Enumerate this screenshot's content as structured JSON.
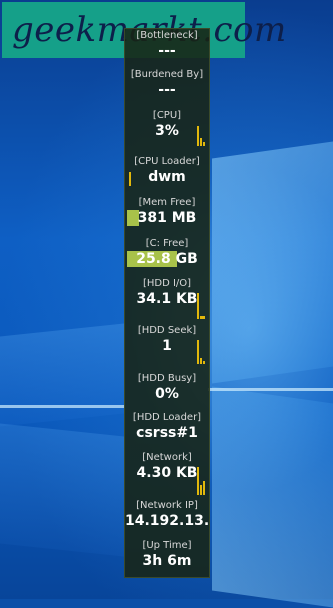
{
  "watermark": {
    "text": "geekmarkt.com"
  },
  "gadget": {
    "items": [
      {
        "label": "[Bottleneck]",
        "value": "---"
      },
      {
        "label": "[Burdened By]",
        "value": "---"
      },
      {
        "label": "[CPU]",
        "value": "3%"
      },
      {
        "label": "[CPU Loader]",
        "value": "dwm"
      },
      {
        "label": "[Mem Free]",
        "value": "381 MB"
      },
      {
        "label": "[C: Free]",
        "value": "25.8 GB"
      },
      {
        "label": "[HDD I/O]",
        "value": "34.1 KB"
      },
      {
        "label": "[HDD Seek]",
        "value": "1"
      },
      {
        "label": "[HDD Busy]",
        "value": "0%"
      },
      {
        "label": "[HDD Loader]",
        "value": "csrss#1"
      },
      {
        "label": "[Network]",
        "value": "4.30 KB"
      },
      {
        "label": "[Network IP]",
        "value": "14.192.13."
      },
      {
        "label": "[Up Time]",
        "value": "3h 6m"
      }
    ]
  },
  "accent_colors": {
    "graph": "#e2b80c",
    "meter": "#a8c24a",
    "panel": "#18241a"
  }
}
